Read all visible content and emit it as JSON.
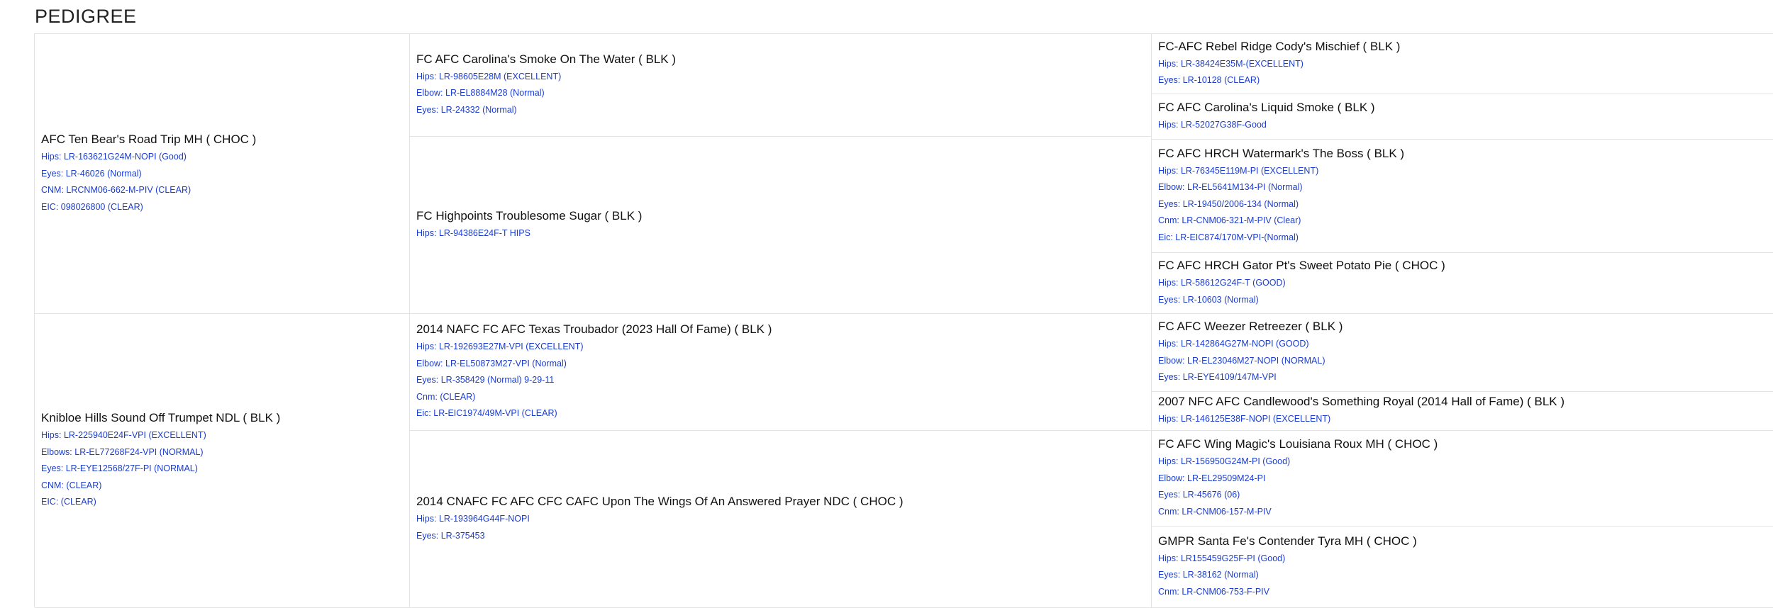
{
  "page": {
    "title": "PEDIGREE"
  },
  "generation1": [
    {
      "name": "AFC Ten Bear's Road Trip MH ( CHOC )",
      "tests": [
        "Hips: LR-163621G24M-NOPI (Good)",
        "Eyes: LR-46026 (Normal)",
        "CNM: LRCNM06-662-M-PIV (CLEAR)",
        "EIC: 098026800 (CLEAR)"
      ]
    },
    {
      "name": "Knibloe Hills Sound Off Trumpet NDL ( BLK )",
      "tests": [
        "Hips: LR-225940E24F-VPI (EXCELLENT)",
        "Elbows: LR-EL77268F24-VPI (NORMAL)",
        "Eyes: LR-EYE12568/27F-PI (NORMAL)",
        "CNM: (CLEAR)",
        "EIC: (CLEAR)"
      ]
    }
  ],
  "generation2": [
    {
      "name": "FC AFC Carolina's Smoke On The Water ( BLK )",
      "tests": [
        "Hips: LR-98605E28M (EXCELLENT)",
        "Elbow: LR-EL8884M28 (Normal)",
        "Eyes: LR-24332 (Normal)"
      ]
    },
    {
      "name": "FC Highpoints Troublesome Sugar ( BLK )",
      "tests": [
        "Hips: LR-94386E24F-T HIPS"
      ]
    },
    {
      "name": "2014 NAFC FC AFC Texas Troubador (2023 Hall Of Fame) ( BLK )",
      "tests": [
        "Hips: LR-192693E27M-VPI (EXCELLENT)",
        "Elbow: LR-EL50873M27-VPI (Normal)",
        "Eyes: LR-358429 (Normal) 9-29-11",
        "Cnm: (CLEAR)",
        "Eic: LR-EIC1974/49M-VPI (CLEAR)"
      ]
    },
    {
      "name": "2014 CNAFC FC AFC CFC CAFC Upon The Wings Of An Answered Prayer NDC ( CHOC )",
      "tests": [
        "Hips: LR-193964G44F-NOPI",
        "Eyes: LR-375453"
      ]
    }
  ],
  "generation3": [
    {
      "name": "FC-AFC Rebel Ridge Cody's Mischief ( BLK )",
      "tests": [
        "Hips: LR-38424E35M-(EXCELLENT)",
        "Eyes: LR-10128 (CLEAR)"
      ]
    },
    {
      "name": "FC AFC Carolina's Liquid Smoke ( BLK )",
      "tests": [
        "Hips: LR-52027G38F-Good"
      ]
    },
    {
      "name": "FC AFC HRCH Watermark's The Boss ( BLK )",
      "tests": [
        "Hips: LR-76345E119M-PI (EXCELLENT)",
        "Elbow: LR-EL5641M134-PI (Normal)",
        "Eyes: LR-19450/2006-134 (Normal)",
        "Cnm: LR-CNM06-321-M-PIV (Clear)",
        "Eic: LR-EIC874/170M-VPI-(Normal)"
      ]
    },
    {
      "name": "FC AFC HRCH Gator Pt's Sweet Potato Pie ( CHOC )",
      "tests": [
        "Hips: LR-58612G24F-T (GOOD)",
        "Eyes: LR-10603 (Normal)"
      ]
    },
    {
      "name": "FC AFC Weezer Retreezer ( BLK )",
      "tests": [
        "Hips: LR-142864G27M-NOPI (GOOD)",
        "Elbow: LR-EL23046M27-NOPI (NORMAL)",
        "Eyes: LR-EYE4109/147M-VPI"
      ]
    },
    {
      "name": "2007 NFC AFC Candlewood's Something Royal (2014 Hall of Fame) ( BLK )",
      "tests": [
        "Hips: LR-146125E38F-NOPI (EXCELLENT)"
      ]
    },
    {
      "name": "FC AFC Wing Magic's Louisiana Roux MH ( CHOC )",
      "tests": [
        "Hips: LR-156950G24M-PI (Good)",
        "Elbow: LR-EL29509M24-PI",
        "Eyes: LR-45676 (06)",
        "Cnm: LR-CNM06-157-M-PIV"
      ]
    },
    {
      "name": "GMPR Santa Fe's Contender Tyra MH ( CHOC )",
      "tests": [
        "Hips: LR155459G25F-PI (Good)",
        "Eyes: LR-38162 (Normal)",
        "Cnm: LR-CNM06-753-F-PIV"
      ]
    }
  ]
}
